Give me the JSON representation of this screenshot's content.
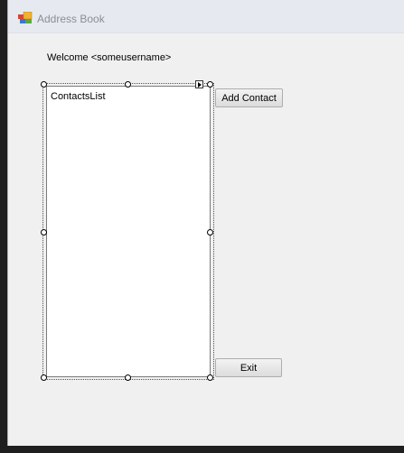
{
  "window": {
    "title": "Address Book",
    "icon": "address-book-app-icon"
  },
  "form": {
    "welcome_text": "Welcome <someusername>",
    "contacts_list_label": "ContactsList",
    "add_contact_label": "Add Contact",
    "exit_label": "Exit"
  },
  "designer": {
    "selected_control": "contacts-list",
    "smart_tag_icon": "smart-tag-arrow-icon"
  },
  "colors": {
    "form_background": "#f0f0f0",
    "titlebar": "#e6e9ef",
    "title_text": "#8a8f96"
  }
}
